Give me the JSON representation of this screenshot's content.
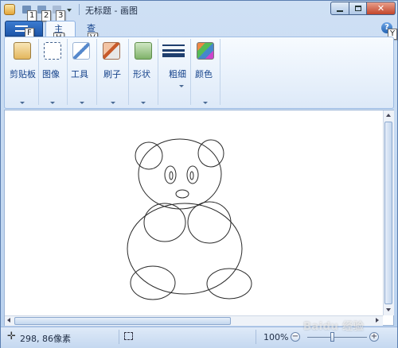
{
  "window": {
    "title": "无标题 - 画图",
    "keytips": {
      "q1": "1",
      "q2": "2",
      "q3": "3",
      "file": "F",
      "home": "H",
      "view": "V",
      "help": "Y"
    }
  },
  "tabs": [
    {
      "label": "主页",
      "active": true
    },
    {
      "label": "查看",
      "active": false
    }
  ],
  "help_label": "?",
  "ribbon": {
    "groups": [
      {
        "label": "剪贴板",
        "icon": "clipboard-icon"
      },
      {
        "label": "图像",
        "icon": "image-select-icon"
      },
      {
        "label": "工具",
        "icon": "tools-icon"
      },
      {
        "label": "刷子",
        "icon": "brush-icon"
      },
      {
        "label": "形状",
        "icon": "shapes-icon"
      },
      {
        "label": "粗细",
        "icon": "line-width-icon"
      },
      {
        "label": "颜色",
        "icon": "colors-icon"
      }
    ]
  },
  "status": {
    "position": "298, 86像素",
    "zoom": "100%",
    "zoom_level": 1.0
  },
  "watermark": "Baidu 经验",
  "colors": {
    "accent": "#1d56a9",
    "ribbon": "#dde9f8",
    "canvas": "#ffffff",
    "stroke": "#2a2a2a"
  }
}
